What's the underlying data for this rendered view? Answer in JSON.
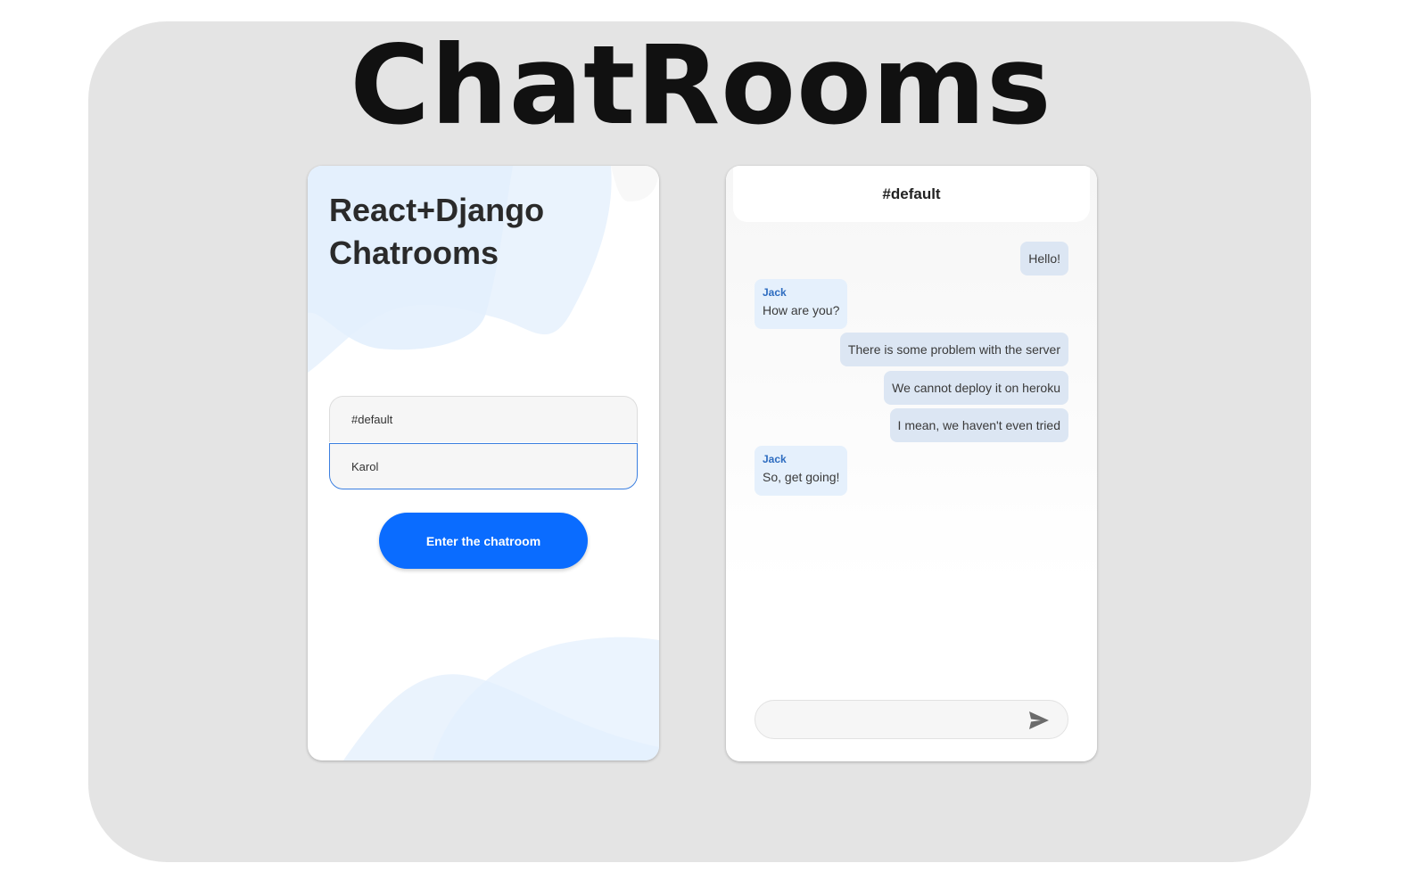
{
  "title": "ChatRooms",
  "login": {
    "heading": "React+Django Chatrooms",
    "room_value": "#default",
    "name_value": "Karol",
    "enter_label": "Enter the chatroom"
  },
  "chat": {
    "room_name": "#default",
    "messages": [
      {
        "own": true,
        "text": "Hello!"
      },
      {
        "own": false,
        "author": "Jack",
        "text": "How are you?"
      },
      {
        "own": true,
        "text": "There is some problem with the server"
      },
      {
        "own": true,
        "text": "We cannot deploy it on heroku"
      },
      {
        "own": true,
        "text": "I mean, we haven't even tried"
      },
      {
        "own": false,
        "author": "Jack",
        "text": "So, get going!"
      }
    ],
    "composer_value": "",
    "send_icon": "send-icon"
  },
  "colors": {
    "accent": "#0a6cff",
    "own_bubble": "#dce6f3",
    "other_bubble": "#e5f0fc",
    "author": "#2d6cc0"
  }
}
